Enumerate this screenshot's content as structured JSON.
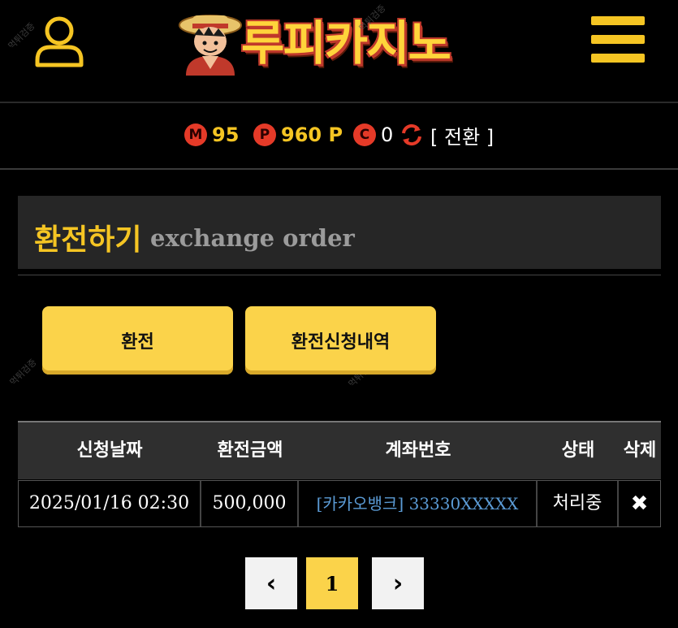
{
  "header": {
    "logo_text": "루피카지노",
    "user_icon": "user-icon",
    "menu_icon": "hamburger-menu-icon",
    "watermark": "먹튀검증"
  },
  "points": {
    "money_badge": "M",
    "money_value": "95",
    "point_badge": "P",
    "point_value": "960 P",
    "casino_badge": "C",
    "casino_value": "0",
    "swap_icon": "refresh-icon",
    "swap_label": "[ 전환 ]"
  },
  "page_title": {
    "korean": "환전하기",
    "english": "exchange order"
  },
  "buttons": {
    "exchange": "환전",
    "history": "환전신청내역"
  },
  "table": {
    "headers": [
      "신청날짜",
      "환전금액",
      "계좌번호",
      "상태",
      "삭제"
    ],
    "rows": [
      {
        "date": "2025/01/16 02:30",
        "amount": "500,000",
        "account": "[카카오뱅크] 33330XXXXX",
        "status": "처리중",
        "delete": "✖"
      }
    ]
  },
  "pagination": {
    "prev": "‹",
    "current": "1",
    "next": "›"
  },
  "colors": {
    "accent": "#f5c523",
    "badge": "#e53a28",
    "link": "#5b9bd5",
    "panel": "#262626"
  }
}
